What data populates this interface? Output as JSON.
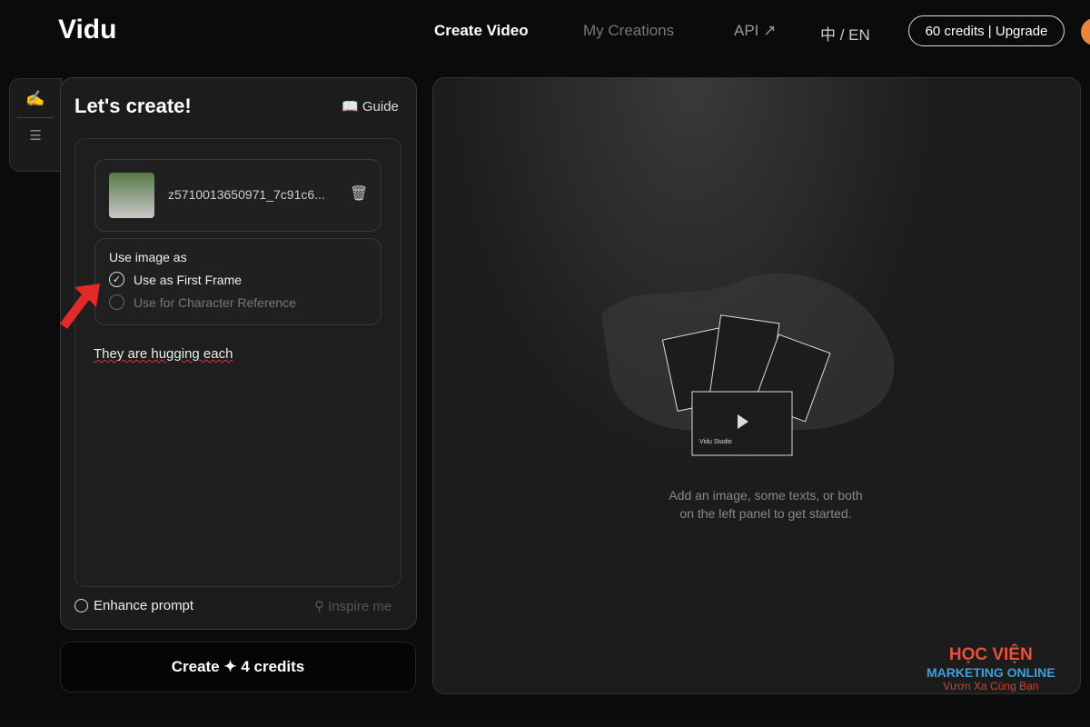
{
  "header": {
    "logo": "Vidu",
    "nav": [
      "Create Video",
      "My Creations",
      "API ↗",
      "中 / EN"
    ],
    "credits": "60 credits | Upgrade"
  },
  "panel": {
    "title": "Let's create!",
    "guide": "Guide",
    "file_name": "z5710013650971_7c91c6...",
    "use_as_label": "Use image as",
    "options": [
      {
        "label": "Use as First Frame",
        "selected": true
      },
      {
        "label": "Use for Character Reference",
        "selected": false
      }
    ],
    "prompt": "They are hugging each",
    "enhance": "Enhance prompt",
    "inspire": "Inspire me",
    "create_button": "Create ✦ 4 credits"
  },
  "main": {
    "hint_line1": "Add an image, some texts, or both",
    "hint_line2": "on the left panel to get started.",
    "illustration_text": "Vidu Studio"
  },
  "watermark": {
    "line1": "HỌC VIỆN",
    "line2": "MARKETING ONLINE",
    "line3": "Vươn Xa Cùng Bạn"
  },
  "colors": {
    "accent": "#e8843c",
    "arrow": "#e32a2a"
  }
}
